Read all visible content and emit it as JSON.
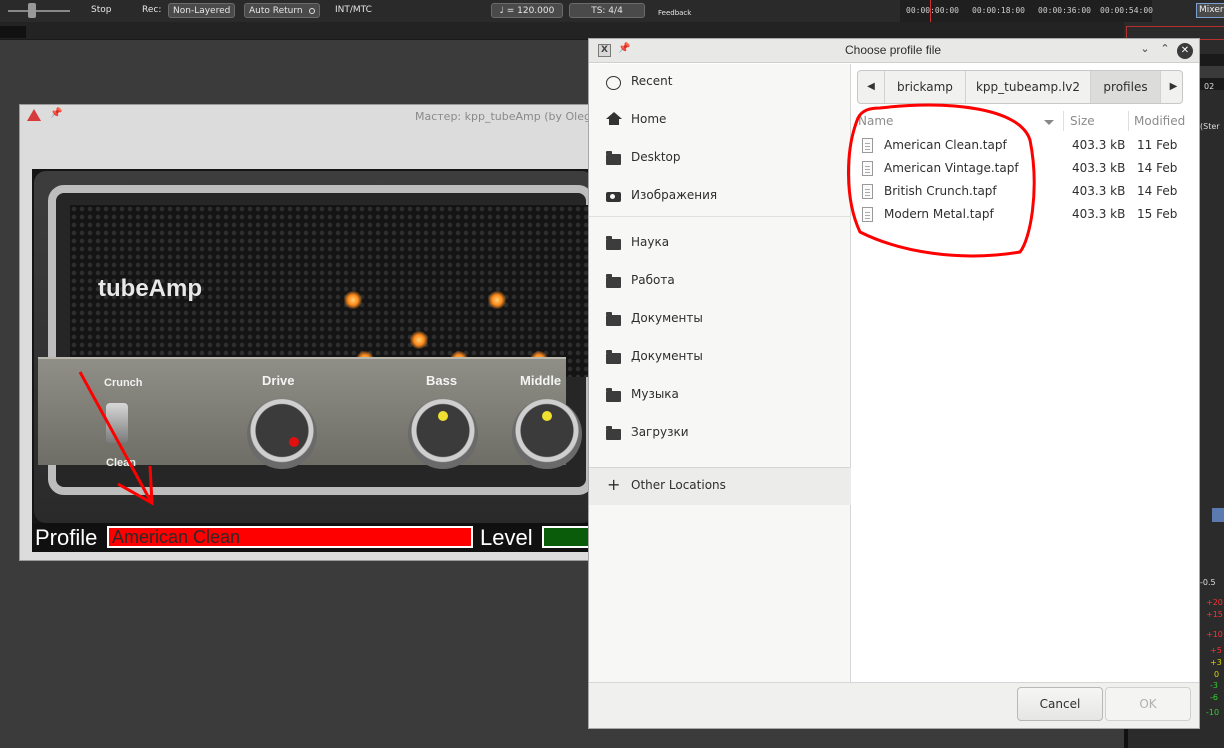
{
  "daw": {
    "transport_stop": "Stop",
    "rec_label": "Rec:",
    "rec_mode": "Non-Layered",
    "auto_return": "Auto Return",
    "sync": "INT/MTC",
    "tempo": "♩ = 120.000",
    "time_sig": "TS: 4/4",
    "feedback": "Feedback",
    "timeline_ticks": [
      "00:00:00:00",
      "00:00:18:00",
      "00:00:36:00",
      "00:00:54:00"
    ],
    "mixer_button": "Mixer",
    "meter_values": [
      "-0.5",
      "+20",
      "+15",
      "+10",
      "+5",
      "+3",
      "0",
      "-3",
      "-6",
      "-10"
    ],
    "strip_label_02": "02",
    "strip_label_stereo": "(Ster",
    "colors": {
      "meter_red": "#ff3030",
      "meter_yellow": "#d6d600",
      "meter_green": "#30d030"
    }
  },
  "plugin": {
    "window_title": "Мастер: kpp_tubeAmp (by Oleg",
    "brand": "tubeAmp",
    "toggle_top": "Crunch",
    "toggle_bottom": "Clean",
    "knobs": {
      "drive": "Drive",
      "bass": "Bass",
      "middle": "Middle"
    },
    "profile_label": "Profile",
    "profile_value": "American Clean",
    "level_label": "Level",
    "colors": {
      "profile_field": "#ff0000",
      "level_field": "#0a5c0a"
    }
  },
  "dialog": {
    "title": "Choose profile file",
    "window_buttons": {
      "menu": "⌄",
      "maximize": "⌃",
      "close": "✕"
    },
    "sidebar": [
      {
        "label": "Recent",
        "icon": "clock-icon"
      },
      {
        "label": "Home",
        "icon": "home-icon"
      },
      {
        "label": "Desktop",
        "icon": "folder-icon"
      },
      {
        "label": "Изображения",
        "icon": "camera-icon"
      },
      {
        "label": "Наука",
        "icon": "folder-icon"
      },
      {
        "label": "Работа",
        "icon": "folder-icon"
      },
      {
        "label": "Документы",
        "icon": "folder-icon"
      },
      {
        "label": "Документы",
        "icon": "folder-icon"
      },
      {
        "label": "Музыка",
        "icon": "folder-icon"
      },
      {
        "label": "Загрузки",
        "icon": "folder-icon"
      }
    ],
    "other_locations": "Other Locations",
    "path": [
      "brickamp",
      "kpp_tubeamp.lv2",
      "profiles"
    ],
    "columns": {
      "name": "Name",
      "size": "Size",
      "modified": "Modified"
    },
    "files": [
      {
        "name": "American Clean.tapf",
        "size": "403.3 kB",
        "modified": "11 Feb"
      },
      {
        "name": "American Vintage.tapf",
        "size": "403.3 kB",
        "modified": "14 Feb"
      },
      {
        "name": "British Crunch.tapf",
        "size": "403.3 kB",
        "modified": "14 Feb"
      },
      {
        "name": "Modern Metal.tapf",
        "size": "403.3 kB",
        "modified": "15 Feb"
      }
    ],
    "cancel_label": "Cancel",
    "ok_label": "OK"
  },
  "annotation_color": "#ff0000"
}
